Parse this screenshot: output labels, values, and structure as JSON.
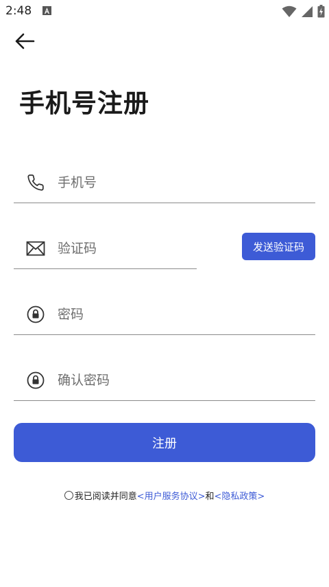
{
  "status_bar": {
    "time": "2:48",
    "notification_icon": "a-letter-icon",
    "right_icons": [
      "wifi-icon",
      "signal-icon",
      "battery-charging-icon"
    ]
  },
  "nav": {
    "back_icon": "arrow-left-icon"
  },
  "page": {
    "title": "手机号注册"
  },
  "form": {
    "phone": {
      "icon": "phone-icon",
      "placeholder": "手机号",
      "value": ""
    },
    "code": {
      "icon": "mail-icon",
      "placeholder": "验证码",
      "value": ""
    },
    "send_code_label": "发送验证码",
    "password": {
      "icon": "lock-icon",
      "placeholder": "密码",
      "value": ""
    },
    "confirm_password": {
      "icon": "lock-icon",
      "placeholder": "确认密码",
      "value": ""
    },
    "submit_label": "注册"
  },
  "agreement": {
    "prefix": "我已阅读并同意",
    "service_link": "<用户服务协议>",
    "conjunction": "和",
    "privacy_link": "<隐私政策>",
    "checked": false
  },
  "colors": {
    "accent": "#3d5bd6",
    "text": "#1a1a1a",
    "placeholder": "#6e6e6e",
    "divider": "#8a8a8a"
  }
}
